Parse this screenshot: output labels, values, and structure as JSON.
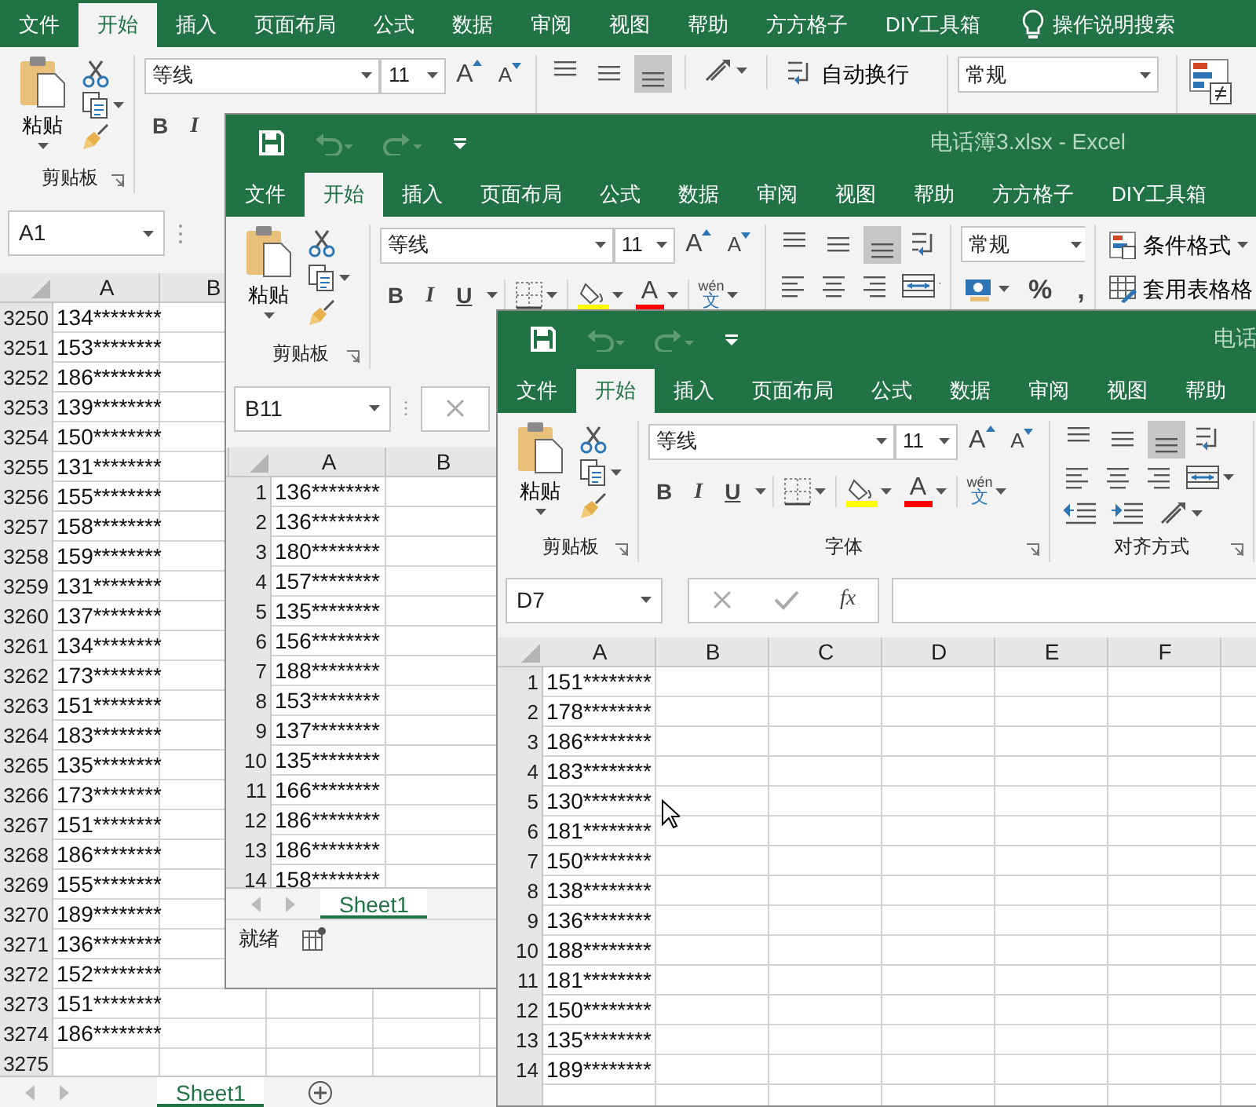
{
  "windows": [
    {
      "tabs": [
        {
          "label": "文件",
          "selected": false
        },
        {
          "label": "开始",
          "selected": true
        },
        {
          "label": "插入",
          "selected": false
        },
        {
          "label": "页面布局",
          "selected": false
        },
        {
          "label": "公式",
          "selected": false
        },
        {
          "label": "数据",
          "selected": false
        },
        {
          "label": "审阅",
          "selected": false
        },
        {
          "label": "视图",
          "selected": false
        },
        {
          "label": "帮助",
          "selected": false
        },
        {
          "label": "方方格子",
          "selected": false
        },
        {
          "label": "DIY工具箱",
          "selected": false
        }
      ],
      "search": "操作说明搜索",
      "ribbon": [
        {
          "kind": "clipboard",
          "paste": "粘贴",
          "label": "剪贴板"
        },
        {
          "kind": "font",
          "font": "等线",
          "size": "11",
          "size_buttons": [
            "A",
            "A"
          ],
          "buttons": [
            "B",
            "I"
          ]
        },
        {
          "kind": "align",
          "compact": true,
          "vertical": [
            {
              "selected": false
            },
            {
              "selected": false
            },
            {
              "selected": true
            }
          ],
          "wrap": "自动换行"
        },
        {
          "kind": "number",
          "format": "常规"
        },
        {
          "kind": "styles"
        }
      ],
      "name_box": "A1",
      "columns": [
        "A",
        "B"
      ],
      "rows": [
        {
          "number": "3250",
          "value": "134********"
        },
        {
          "number": "3251",
          "value": "153********"
        },
        {
          "number": "3252",
          "value": "186********"
        },
        {
          "number": "3253",
          "value": "139********"
        },
        {
          "number": "3254",
          "value": "150********"
        },
        {
          "number": "3255",
          "value": "131********"
        },
        {
          "number": "3256",
          "value": "155********"
        },
        {
          "number": "3257",
          "value": "158********"
        },
        {
          "number": "3258",
          "value": "159********"
        },
        {
          "number": "3259",
          "value": "131********"
        },
        {
          "number": "3260",
          "value": "137********"
        },
        {
          "number": "3261",
          "value": "134********"
        },
        {
          "number": "3262",
          "value": "173********"
        },
        {
          "number": "3263",
          "value": "151********"
        },
        {
          "number": "3264",
          "value": "183********"
        },
        {
          "number": "3265",
          "value": "135********"
        },
        {
          "number": "3266",
          "value": "173********"
        },
        {
          "number": "3267",
          "value": "151********"
        },
        {
          "number": "3268",
          "value": "186********"
        },
        {
          "number": "3269",
          "value": "155********"
        },
        {
          "number": "3270",
          "value": "189********"
        },
        {
          "number": "3271",
          "value": "136********"
        },
        {
          "number": "3272",
          "value": "152********"
        },
        {
          "number": "3273",
          "value": "151********"
        },
        {
          "number": "3274",
          "value": "186********"
        },
        {
          "number": "3275"
        }
      ],
      "sheets": [
        {
          "label": "Sheet1",
          "selected": true
        }
      ],
      "add_sheet": true
    },
    {
      "title": "电话簿3.xlsx  -  Excel",
      "tabs": [
        {
          "label": "文件",
          "selected": false
        },
        {
          "label": "开始",
          "selected": true
        },
        {
          "label": "插入",
          "selected": false
        },
        {
          "label": "页面布局",
          "selected": false
        },
        {
          "label": "公式",
          "selected": false
        },
        {
          "label": "数据",
          "selected": false
        },
        {
          "label": "审阅",
          "selected": false
        },
        {
          "label": "视图",
          "selected": false
        },
        {
          "label": "帮助",
          "selected": false
        },
        {
          "label": "方方格子",
          "selected": false
        },
        {
          "label": "DIY工具箱",
          "selected": false
        }
      ],
      "ribbon": [
        {
          "kind": "clipboard",
          "paste": "粘贴",
          "label": "剪贴板"
        },
        {
          "kind": "font",
          "font": "等线",
          "size": "11",
          "size_buttons": [
            "A",
            "A"
          ],
          "buttons": [
            "B",
            "I",
            "U"
          ],
          "color_button": "A",
          "phonetic": [
            "wén",
            "文"
          ]
        },
        {
          "kind": "align",
          "compact": false,
          "indent_row": false,
          "vertical": [
            {
              "selected": false
            },
            {
              "selected": false
            },
            {
              "selected": true
            }
          ]
        },
        {
          "kind": "number",
          "format": "常规",
          "symbols": [
            "%",
            ","
          ]
        },
        {
          "kind": "styles",
          "items": [
            "条件格式",
            "套用表格格"
          ]
        }
      ],
      "name_box": "B11",
      "columns": [
        "A",
        "B"
      ],
      "rows": [
        {
          "number": "1",
          "value": "136********"
        },
        {
          "number": "2",
          "value": "136********"
        },
        {
          "number": "3",
          "value": "180********"
        },
        {
          "number": "4",
          "value": "157********"
        },
        {
          "number": "5",
          "value": "135********"
        },
        {
          "number": "6",
          "value": "156********"
        },
        {
          "number": "7",
          "value": "188********"
        },
        {
          "number": "8",
          "value": "153********"
        },
        {
          "number": "9",
          "value": "137********"
        },
        {
          "number": "10",
          "value": "135********"
        },
        {
          "number": "11",
          "value": "166********"
        },
        {
          "number": "12",
          "value": "186********"
        },
        {
          "number": "13",
          "value": "186********"
        },
        {
          "number": "14",
          "value": "158********"
        }
      ],
      "sheets": [
        {
          "label": "Sheet1",
          "selected": true
        }
      ],
      "status": "就绪"
    },
    {
      "title": "电话",
      "tabs": [
        {
          "label": "文件",
          "selected": false
        },
        {
          "label": "开始",
          "selected": true
        },
        {
          "label": "插入",
          "selected": false
        },
        {
          "label": "页面布局",
          "selected": false
        },
        {
          "label": "公式",
          "selected": false
        },
        {
          "label": "数据",
          "selected": false
        },
        {
          "label": "审阅",
          "selected": false
        },
        {
          "label": "视图",
          "selected": false
        },
        {
          "label": "帮助",
          "selected": false
        }
      ],
      "ribbon": [
        {
          "kind": "clipboard",
          "paste": "粘贴",
          "label": "剪贴板"
        },
        {
          "kind": "font",
          "font": "等线",
          "size": "11",
          "size_buttons": [
            "A",
            "A"
          ],
          "buttons": [
            "B",
            "I",
            "U"
          ],
          "color_button": "A",
          "phonetic": [
            "wén",
            "文"
          ],
          "label": "字体"
        },
        {
          "kind": "align",
          "compact": false,
          "indent_row": true,
          "vertical": [
            {
              "selected": false
            },
            {
              "selected": false
            },
            {
              "selected": true
            }
          ],
          "label": "对齐方式"
        }
      ],
      "name_box": "D7",
      "fx": "fx",
      "columns": [
        "A",
        "B",
        "C",
        "D",
        "E",
        "F"
      ],
      "rows": [
        {
          "number": "1",
          "value": "151********"
        },
        {
          "number": "2",
          "value": "178********"
        },
        {
          "number": "3",
          "value": "186********"
        },
        {
          "number": "4",
          "value": "183********"
        },
        {
          "number": "5",
          "value": "130********"
        },
        {
          "number": "6",
          "value": "181********"
        },
        {
          "number": "7",
          "value": "150********"
        },
        {
          "number": "8",
          "value": "138********"
        },
        {
          "number": "9",
          "value": "136********"
        },
        {
          "number": "10",
          "value": "188********"
        },
        {
          "number": "11",
          "value": "181********"
        },
        {
          "number": "12",
          "value": "150********"
        },
        {
          "number": "13",
          "value": "135********"
        },
        {
          "number": "14",
          "value": "189********"
        }
      ]
    }
  ]
}
